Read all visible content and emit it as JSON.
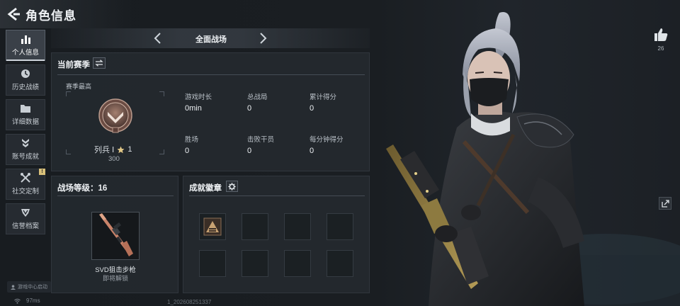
{
  "header": {
    "title": "角色信息"
  },
  "sidebar": {
    "items": [
      {
        "label": "个人信息",
        "icon": "bar-chart-icon",
        "active": true
      },
      {
        "label": "历史战绩",
        "icon": "clock-icon",
        "active": false
      },
      {
        "label": "详细数据",
        "icon": "folder-icon",
        "active": false
      },
      {
        "label": "账号成就",
        "icon": "medal-icon",
        "active": false
      },
      {
        "label": "社交定制",
        "icon": "tools-icon",
        "active": false,
        "badge": "!"
      },
      {
        "label": "信誉档案",
        "icon": "shield-icon",
        "active": false
      }
    ],
    "launcher_tag": "游戏中心启动"
  },
  "mode": {
    "name": "全面战场"
  },
  "season": {
    "title": "当前赛季",
    "best_label": "赛季最高",
    "rank_name": "列兵 Ⅰ",
    "stars": "1",
    "rank_score": "300",
    "stats": [
      {
        "label": "游戏时长",
        "value": "0min"
      },
      {
        "label": "总战局",
        "value": "0"
      },
      {
        "label": "累计得分",
        "value": "0"
      },
      {
        "label": "胜场",
        "value": "0"
      },
      {
        "label": "击败干员",
        "value": "0"
      },
      {
        "label": "每分钟得分",
        "value": "0"
      }
    ]
  },
  "level": {
    "title": "战场等级：16",
    "weapon_name": "SVD狙击步枪",
    "weapon_status": "即将解锁"
  },
  "achievements": {
    "title": "成就徽章"
  },
  "social": {
    "like_count": "26"
  },
  "footer": {
    "ping": "97ms",
    "build": "1_202608251337"
  },
  "colors": {
    "panel_bg": "#24292f",
    "accent_gold": "#d8c07a",
    "text": "#eef1f4"
  }
}
